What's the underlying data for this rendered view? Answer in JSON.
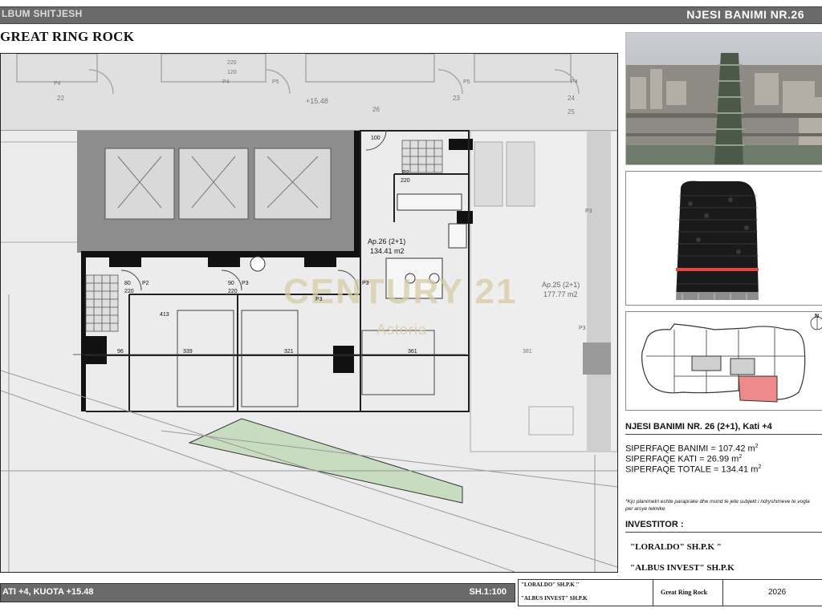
{
  "header": {
    "left_label": "LBUM SHITJESH",
    "right_label": "NJESI BANIMI NR.26"
  },
  "project_title": "GREAT RING ROCK",
  "plan": {
    "apartment_26_label": "Ap.26 (2+1)",
    "apartment_26_area": "134.41 m2",
    "apartment_25_label": "Ap.25 (2+1)",
    "apartment_25_area": "177.77 m2",
    "watermark_brand": "CENTURY 21",
    "watermark_sub": "Astoria",
    "level_mark": "+15.48",
    "door_labels": [
      "P2",
      "P2",
      "P3",
      "P3",
      "P3",
      "P3",
      "P3",
      "P4",
      "P4",
      "P5",
      "P5",
      "P4"
    ],
    "dimension_labels": [
      "339",
      "321",
      "361",
      "381",
      "413",
      "96",
      "80",
      "220",
      "90",
      "220",
      "100",
      "220",
      "120",
      "220"
    ],
    "axis_numbers": [
      "22",
      "23",
      "24",
      "25",
      "26"
    ]
  },
  "footer": {
    "floor_label": "ATI +4, KUOTA +15.48",
    "scale": "SH.1:100"
  },
  "title_block": {
    "owner1": "\"LORALDO\" SH.P.K \"",
    "owner2": "\"ALBUS INVEST\" SH.P.K",
    "project": "Great Ring Rock",
    "year": "2026"
  },
  "unit_info": {
    "heading": "NJESI BANIMI NR. 26 (2+1), Kati +4",
    "areas": [
      {
        "label": "SIPERFAQE BANIMI = 107.42 m",
        "sup": "2"
      },
      {
        "label": "SIPERFAQE KATI = 26.99 m",
        "sup": "2"
      },
      {
        "label": "SIPERFAQE TOTALE = 134.41 m",
        "sup": "2"
      }
    ],
    "note": "*Kjo planimetri eshte paraprake dhe mund te jete subjekt i ndryshimeve te vogla per arsye teknike",
    "investor_label": "INVESTITOR :",
    "investors": [
      "\"LORALDO\" SH.P.K \"",
      "\"ALBUS INVEST\" SH.P.K"
    ]
  },
  "keyplan": {
    "north_label": "N"
  },
  "colors": {
    "header_bg": "#6a6a6a",
    "highlight": "#ee8a8a",
    "green_strip": "#c8dcc0",
    "wall_dark": "#111111",
    "wall_gray": "#8a8a8a",
    "watermark": "#d6cca8"
  }
}
